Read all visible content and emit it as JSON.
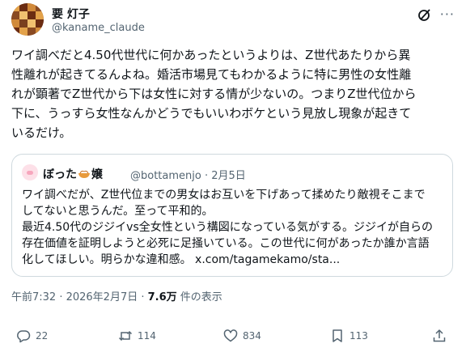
{
  "author": {
    "name": "要 灯子",
    "handle": "@kaname_claude"
  },
  "post": {
    "lines": [
      "ワイ調べだと4.50代世代に何かあったというよりは、Z世代あたりから異",
      "性離れが起きてるんよね。婚活市場見てもわかるように特に男性の女性離",
      "れが顕著でZ世代から下は女性に対する情が少ないの。つまりZ世代位から",
      "下に、うっすら女性なんかどうでもいいわボケという見放し現象が起きて",
      "いるだけ。"
    ]
  },
  "quote": {
    "name_pre": "ぼった",
    "name_post": "嬢",
    "meta": "@bottamenjo · 2月5日",
    "lines": [
      "ワイ調べだが、Z世代位までの男女はお互いを下げあって揉めたり敵視そこまで",
      "してないと思うんだ。至って平和的。",
      "最近4.50代のジジイvs全女性という構図になっている気がする。ジジイが自らの",
      "存在価値を証明しようと必死に足掻いている。この世代に何があったか誰か言語",
      "化してほしい。明らかな違和感。 x.com/tagamekamo/sta..."
    ]
  },
  "meta": {
    "time": "午前7:32 · 2026年2月7日 · ",
    "views": "7.6万",
    "views_suffix": " 件の表示"
  },
  "actions": {
    "replies": "22",
    "reposts": "114",
    "likes": "834",
    "bookmarks": "113"
  },
  "icons": [
    "grok-icon",
    "more-icon",
    "reply-icon",
    "repost-icon",
    "like-icon",
    "bookmark-icon",
    "share-icon"
  ],
  "colors": {
    "text": "#0f1419",
    "secondary": "#536471",
    "border": "#cfd9de"
  }
}
